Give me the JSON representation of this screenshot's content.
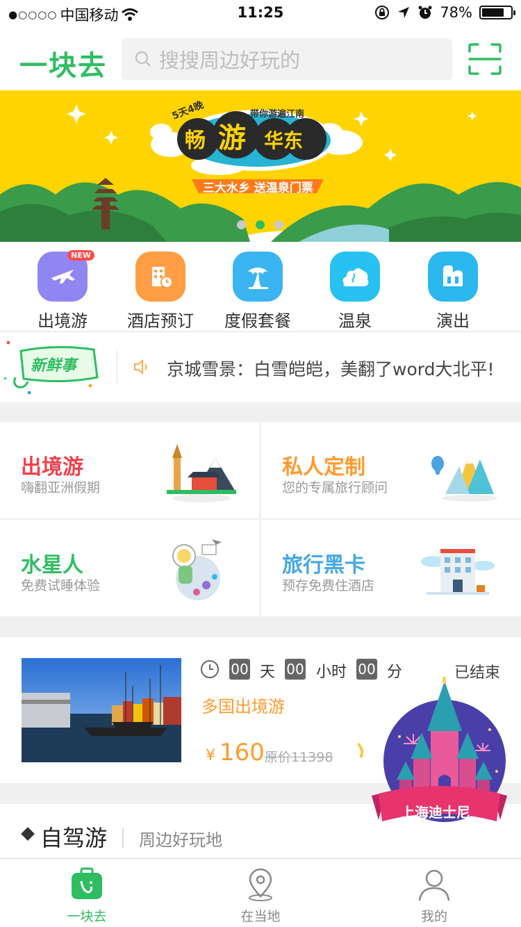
{
  "status_bar": {
    "signal": "●○○○○",
    "carrier": "中国移动",
    "time": "11:25",
    "battery_text": "78%",
    "battery_level": 0.78
  },
  "header": {
    "logo": "一块去",
    "search_placeholder": "搜搜周边好玩的"
  },
  "banner": {
    "tag": "5天4晚",
    "ribbon_text": "带你游遍江南",
    "headline": [
      "畅",
      "游",
      "华东"
    ],
    "subtitle": "三大水乡 送温泉门票",
    "active_index": 1,
    "slide_count": 3
  },
  "categories": [
    {
      "label": "出境游",
      "badge": "NEW",
      "color": "#8f86f2"
    },
    {
      "label": "酒店预订",
      "color": "#ff9e45"
    },
    {
      "label": "度假套餐",
      "color": "#3bb4f2"
    },
    {
      "label": "温泉",
      "color": "#27c2f2"
    },
    {
      "label": "演出",
      "color": "#2ab8ee"
    }
  ],
  "news": {
    "tag": "新鲜事",
    "headline": "京城雪景：白雪皑皑，美翻了word大北平!"
  },
  "features": [
    {
      "title": "出境游",
      "subtitle": "嗨翻亚洲假期",
      "color": "#f0424e"
    },
    {
      "title": "私人定制",
      "subtitle": "您的专属旅行顾问",
      "color": "#ff9a2e"
    },
    {
      "title": "水星人",
      "subtitle": "免费试睡体验",
      "color": "#2fbd62"
    },
    {
      "title": "旅行黑卡",
      "subtitle": "预存免费住酒店",
      "color": "#45a8e6"
    }
  ],
  "deal": {
    "days": "00",
    "day_unit": "天",
    "hours": "00",
    "hour_unit": "小时",
    "minutes": "00",
    "minute_unit": "分",
    "status": "已结束",
    "title": "多国出境游",
    "currency": "¥",
    "price": "160",
    "original_price": "原价11398"
  },
  "self_drive": {
    "title": "自驾游",
    "subtitle": "周边好玩地"
  },
  "promo": {
    "label": "上海迪士尼"
  },
  "tabbar": {
    "items": [
      {
        "label": "一块去",
        "active": true
      },
      {
        "label": "在当地",
        "active": false
      },
      {
        "label": "我的",
        "active": false
      }
    ],
    "active_color": "#2fbd62",
    "inactive_color": "#888888"
  }
}
